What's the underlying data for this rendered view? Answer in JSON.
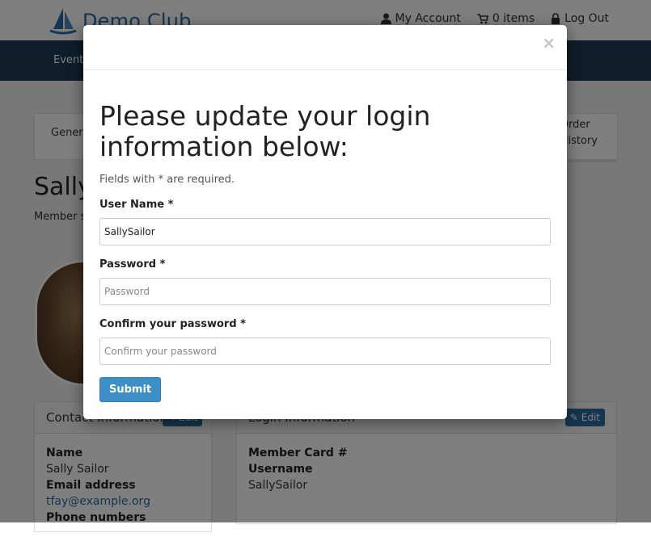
{
  "header": {
    "brand": "Demo Club",
    "my_account": "My Account",
    "cart": "0 items",
    "logout": "Log Out"
  },
  "nav": {
    "events": "Events"
  },
  "tabs": {
    "general": "General",
    "order_history_1": "Order",
    "order_history_2": "History"
  },
  "profile": {
    "name": "Sally",
    "member_since": "Member si"
  },
  "contact_card": {
    "title": "Contact Information",
    "edit": "Edit",
    "name_label": "Name",
    "name_value": "Sally Sailor",
    "email_label": "Email address",
    "email_value": "tfay@example.org",
    "phone_label": "Phone numbers"
  },
  "login_card": {
    "title": "Login Information",
    "edit": "Edit",
    "card_label": "Member Card #",
    "username_label": "Username",
    "username_value": "SallySailor"
  },
  "modal": {
    "close": "×",
    "title": "Please update your login information below:",
    "required_note": "Fields with * are required.",
    "username_label": "User Name *",
    "username_value": "SallySailor",
    "password_label": "Password *",
    "password_placeholder": "Password",
    "confirm_label": "Confirm your password *",
    "confirm_placeholder": "Confirm your password",
    "submit": "Submit"
  }
}
